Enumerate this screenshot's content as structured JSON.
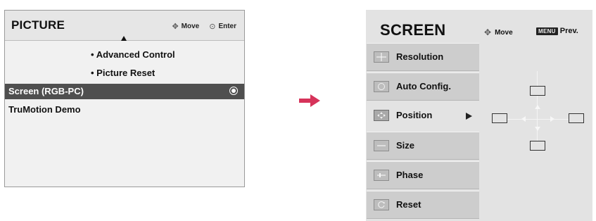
{
  "picture_menu": {
    "title": "PICTURE",
    "hint_move": "Move",
    "hint_enter": "Enter",
    "items": [
      {
        "label": "Advanced Control"
      },
      {
        "label": "Picture Reset"
      },
      {
        "label": "Screen (RGB-PC)",
        "selected": true
      },
      {
        "label": "TruMotion Demo"
      }
    ]
  },
  "transition_arrow_color": "#d6335a",
  "screen_menu": {
    "title": "SCREEN",
    "hint_move": "Move",
    "menu_key": "MENU",
    "hint_prev": "Prev.",
    "items": [
      {
        "label": "Resolution",
        "icon": "plus-icon"
      },
      {
        "label": "Auto Config.",
        "icon": "auto-config-icon"
      },
      {
        "label": "Position",
        "icon": "position-icon",
        "active": true
      },
      {
        "label": "Size",
        "icon": "size-icon"
      },
      {
        "label": "Phase",
        "icon": "phase-icon"
      },
      {
        "label": "Reset",
        "icon": "reset-icon"
      }
    ]
  }
}
